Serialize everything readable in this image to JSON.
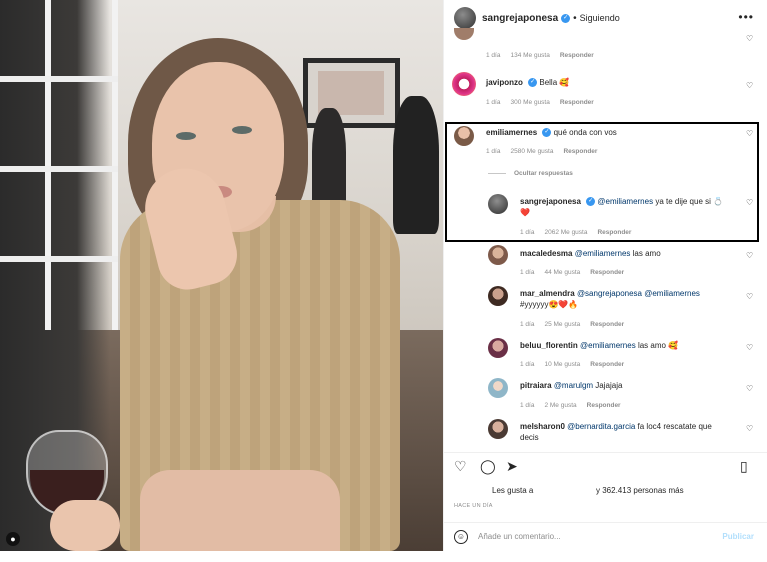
{
  "header": {
    "username": "sangrejaponesa",
    "follow_status": "Siguiendo",
    "more": "•••"
  },
  "comments": [
    {
      "user": "",
      "text": "",
      "meta_time": "1 día",
      "meta_likes": "134 Me gusta",
      "meta_reply": "Responder"
    },
    {
      "user": "javiponzo",
      "text": "Bella 🥰",
      "meta_time": "1 día",
      "meta_likes": "300 Me gusta",
      "meta_reply": "Responder"
    },
    {
      "user": "emiliamernes",
      "text": "qué onda con vos",
      "meta_time": "1 día",
      "meta_likes": "2580 Me gusta",
      "meta_reply": "Responder"
    },
    {
      "user": "sangrejaponesa",
      "mention": "@emiliamernes",
      "text": " ya te dije que si 💍",
      "text2": "❤️",
      "meta_time": "1 día",
      "meta_likes": "2062 Me gusta",
      "meta_reply": "Responder"
    },
    {
      "user": "macaledesma",
      "mention": "@emiliamernes",
      "text": " las amo",
      "meta_time": "1 día",
      "meta_likes": "44 Me gusta",
      "meta_reply": "Responder"
    },
    {
      "user": "mar_almendra",
      "mention": "@sangrejaponesa @emiliamernes",
      "text": "",
      "text2": "#yyyyyy😍❤️🔥",
      "meta_time": "1 día",
      "meta_likes": "25 Me gusta",
      "meta_reply": "Responder"
    },
    {
      "user": "beluu_florentin",
      "mention": "@emiliamernes",
      "text": " las amo 🥰",
      "meta_time": "1 día",
      "meta_likes": "10 Me gusta",
      "meta_reply": "Responder"
    },
    {
      "user": "pitraiara",
      "mention": "@marulgm",
      "text": " Jajajaja",
      "meta_time": "1 día",
      "meta_likes": "2 Me gusta",
      "meta_reply": "Responder"
    },
    {
      "user": "melsharon0",
      "mention": "@bernardita.garcia",
      "text": " fa loc4 rescatate que",
      "text2": "decis",
      "meta_time": "",
      "meta_likes": "",
      "meta_reply": ""
    }
  ],
  "hide_replies": "Ocultar respuestas",
  "likes": {
    "prefix": "Les gusta a",
    "suffix": "y 362.413 personas más"
  },
  "time_ago": "HACE UN DÍA",
  "add_comment": {
    "placeholder": "Añade un comentario...",
    "publish": "Publicar"
  },
  "icons": {
    "heart": "heart-icon",
    "comment": "comment-icon",
    "share": "share-icon",
    "save": "bookmark-icon"
  },
  "colors": {
    "verified": "#3897f0",
    "mention": "#00376b",
    "meta": "#8e8e8e"
  }
}
